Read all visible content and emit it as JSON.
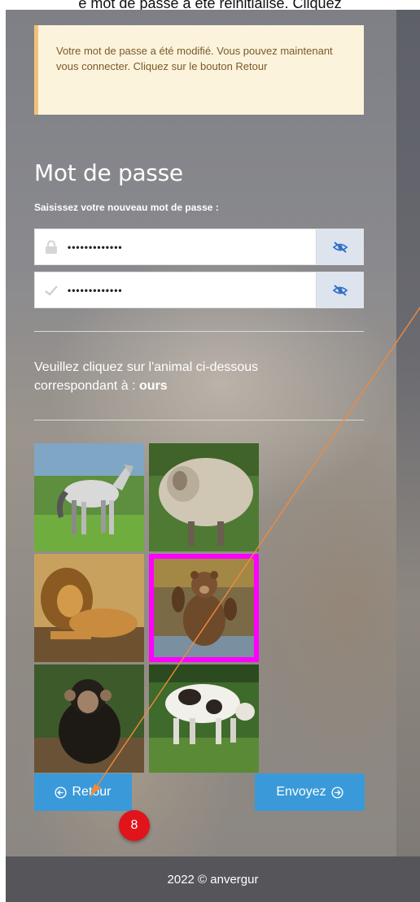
{
  "top_caption": "e mot de passe a été réinitialisé. Cliquez",
  "alert": {
    "message": "Votre mot de passe a été modifié. Vous pouvez maintenant vous connecter. Cliquez sur le bouton Retour"
  },
  "form": {
    "title": "Mot de passe",
    "subtitle": "Saisissez votre nouveau mot de passe :",
    "password_value": "•••••••••••••",
    "confirm_value": "•••••••••••••"
  },
  "captcha": {
    "instruction": "Veuillez cliquez sur l'animal ci-dessous correspondant à :",
    "target": "ours",
    "selected": "bear",
    "images": [
      "horse",
      "sheep",
      "lion",
      "bear",
      "chimpanzee",
      "cow"
    ]
  },
  "buttons": {
    "back_label": "Retour",
    "submit_label": "Envoyez"
  },
  "annotation": {
    "badge_number": "8"
  },
  "footer": {
    "text": "2022 © anvergur"
  },
  "colors": {
    "accent_button": "#3a9ad9",
    "alert_bg": "#fcf3dc",
    "selection_border": "#ff00ff",
    "badge": "#e0141a",
    "arrow": "#f08a3c"
  }
}
